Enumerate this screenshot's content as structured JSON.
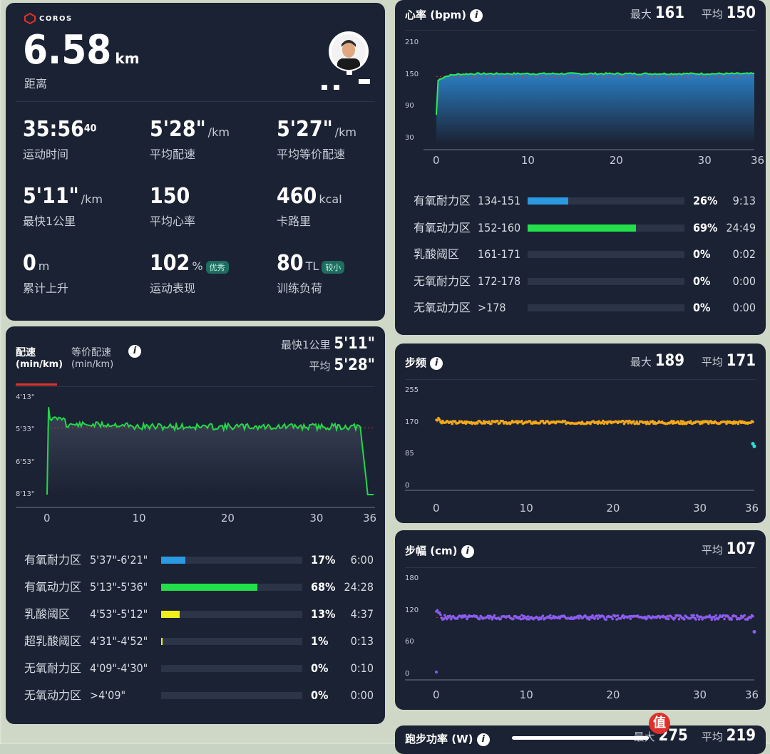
{
  "summary": {
    "brand": "COROS",
    "distance_value": "6.58",
    "distance_unit": "km",
    "distance_label": "距离",
    "stats": [
      {
        "value": "35:56",
        "sup": "40",
        "unit": "",
        "label": "运动时间",
        "badge": ""
      },
      {
        "value": "5'28\"",
        "sup": "",
        "unit": "/km",
        "label": "平均配速",
        "badge": ""
      },
      {
        "value": "5'27\"",
        "sup": "",
        "unit": "/km",
        "label": "平均等价配速",
        "badge": ""
      },
      {
        "value": "5'11\"",
        "sup": "",
        "unit": "/km",
        "label": "最快1公里",
        "badge": ""
      },
      {
        "value": "150",
        "sup": "",
        "unit": "",
        "label": "平均心率",
        "badge": ""
      },
      {
        "value": "460",
        "sup": "",
        "unit": "kcal",
        "label": "卡路里",
        "badge": ""
      },
      {
        "value": "0",
        "sup": "",
        "unit": "m",
        "label": "累计上升",
        "badge": ""
      },
      {
        "value": "102",
        "sup": "",
        "unit": "%",
        "label": "运动表现",
        "badge": "优秀"
      },
      {
        "value": "80",
        "sup": "",
        "unit": "TL",
        "label": "训练负荷",
        "badge": "较小"
      }
    ]
  },
  "pace": {
    "title": "配速",
    "title_unit": "(min/km)",
    "title2": "等价配速",
    "title2_unit": "(min/km)",
    "fastest_label": "最快1公里",
    "fastest_value": "5'11\"",
    "avg_label": "平均",
    "avg_value": "5'28\"",
    "y_ticks": [
      "4'13\"",
      "5'33\"",
      "6'53\"",
      "8'13\""
    ],
    "x_ticks": [
      "0",
      "10",
      "20",
      "30",
      "36"
    ],
    "zones": [
      {
        "name": "有氧耐力区",
        "range": "5'37\"-6'21\"",
        "pct": "17%",
        "time": "6:00",
        "fill": 0.17,
        "color": "#2b9ae0"
      },
      {
        "name": "有氧动力区",
        "range": "5'13\"-5'36\"",
        "pct": "68%",
        "time": "24:28",
        "fill": 0.68,
        "color": "#22e04a"
      },
      {
        "name": "乳酸阈区",
        "range": "4'53\"-5'12\"",
        "pct": "13%",
        "time": "4:37",
        "fill": 0.13,
        "color": "#f2ee1a"
      },
      {
        "name": "超乳酸阈区",
        "range": "4'31\"-4'52\"",
        "pct": "1%",
        "time": "0:13",
        "fill": 0.01,
        "color": "#f2ee1a"
      },
      {
        "name": "无氧耐力区",
        "range": "4'09\"-4'30\"",
        "pct": "0%",
        "time": "0:10",
        "fill": 0,
        "color": "#f08c1a"
      },
      {
        "name": "无氧动力区",
        "range": ">4'09\"",
        "pct": "0%",
        "time": "0:00",
        "fill": 0,
        "color": "#e0302a"
      }
    ]
  },
  "heart_rate": {
    "title": "心率 (bpm)",
    "max_label": "最大",
    "max_value": "161",
    "avg_label": "平均",
    "avg_value": "150",
    "y_ticks": [
      "210",
      "150",
      "90",
      "30"
    ],
    "x_ticks": [
      "0",
      "10",
      "20",
      "30",
      "36"
    ],
    "zones": [
      {
        "name": "有氧耐力区",
        "range": "134-151",
        "pct": "26%",
        "time": "9:13",
        "fill": 0.26,
        "color": "#2b9ae0"
      },
      {
        "name": "有氧动力区",
        "range": "152-160",
        "pct": "69%",
        "time": "24:49",
        "fill": 0.69,
        "color": "#22e04a"
      },
      {
        "name": "乳酸阈区",
        "range": "161-171",
        "pct": "0%",
        "time": "0:02",
        "fill": 0,
        "color": "#f2ee1a"
      },
      {
        "name": "无氧耐力区",
        "range": "172-178",
        "pct": "0%",
        "time": "0:00",
        "fill": 0,
        "color": "#f08c1a"
      },
      {
        "name": "无氧动力区",
        "range": ">178",
        "pct": "0%",
        "time": "0:00",
        "fill": 0,
        "color": "#e0302a"
      }
    ]
  },
  "cadence": {
    "title": "步频",
    "max_label": "最大",
    "max_value": "189",
    "avg_label": "平均",
    "avg_value": "171",
    "y_ticks": [
      "255",
      "170",
      "85",
      "0"
    ],
    "x_ticks": [
      "0",
      "10",
      "20",
      "30",
      "36"
    ]
  },
  "stride": {
    "title": "步幅 (cm)",
    "avg_label": "平均",
    "avg_value": "107",
    "y_ticks": [
      "180",
      "120",
      "60",
      "0"
    ],
    "x_ticks": [
      "0",
      "10",
      "20",
      "30",
      "36"
    ]
  },
  "power": {
    "title": "跑步功率 (W)",
    "max_label": "最大",
    "max_value": "275",
    "avg_label": "平均",
    "avg_value": "219"
  },
  "colors": {
    "card": "#1b2233",
    "hr_line": "#2ee85a",
    "pace_line": "#22d84a",
    "cadence": "#f2a81a",
    "stride": "#8a5cf0"
  }
}
